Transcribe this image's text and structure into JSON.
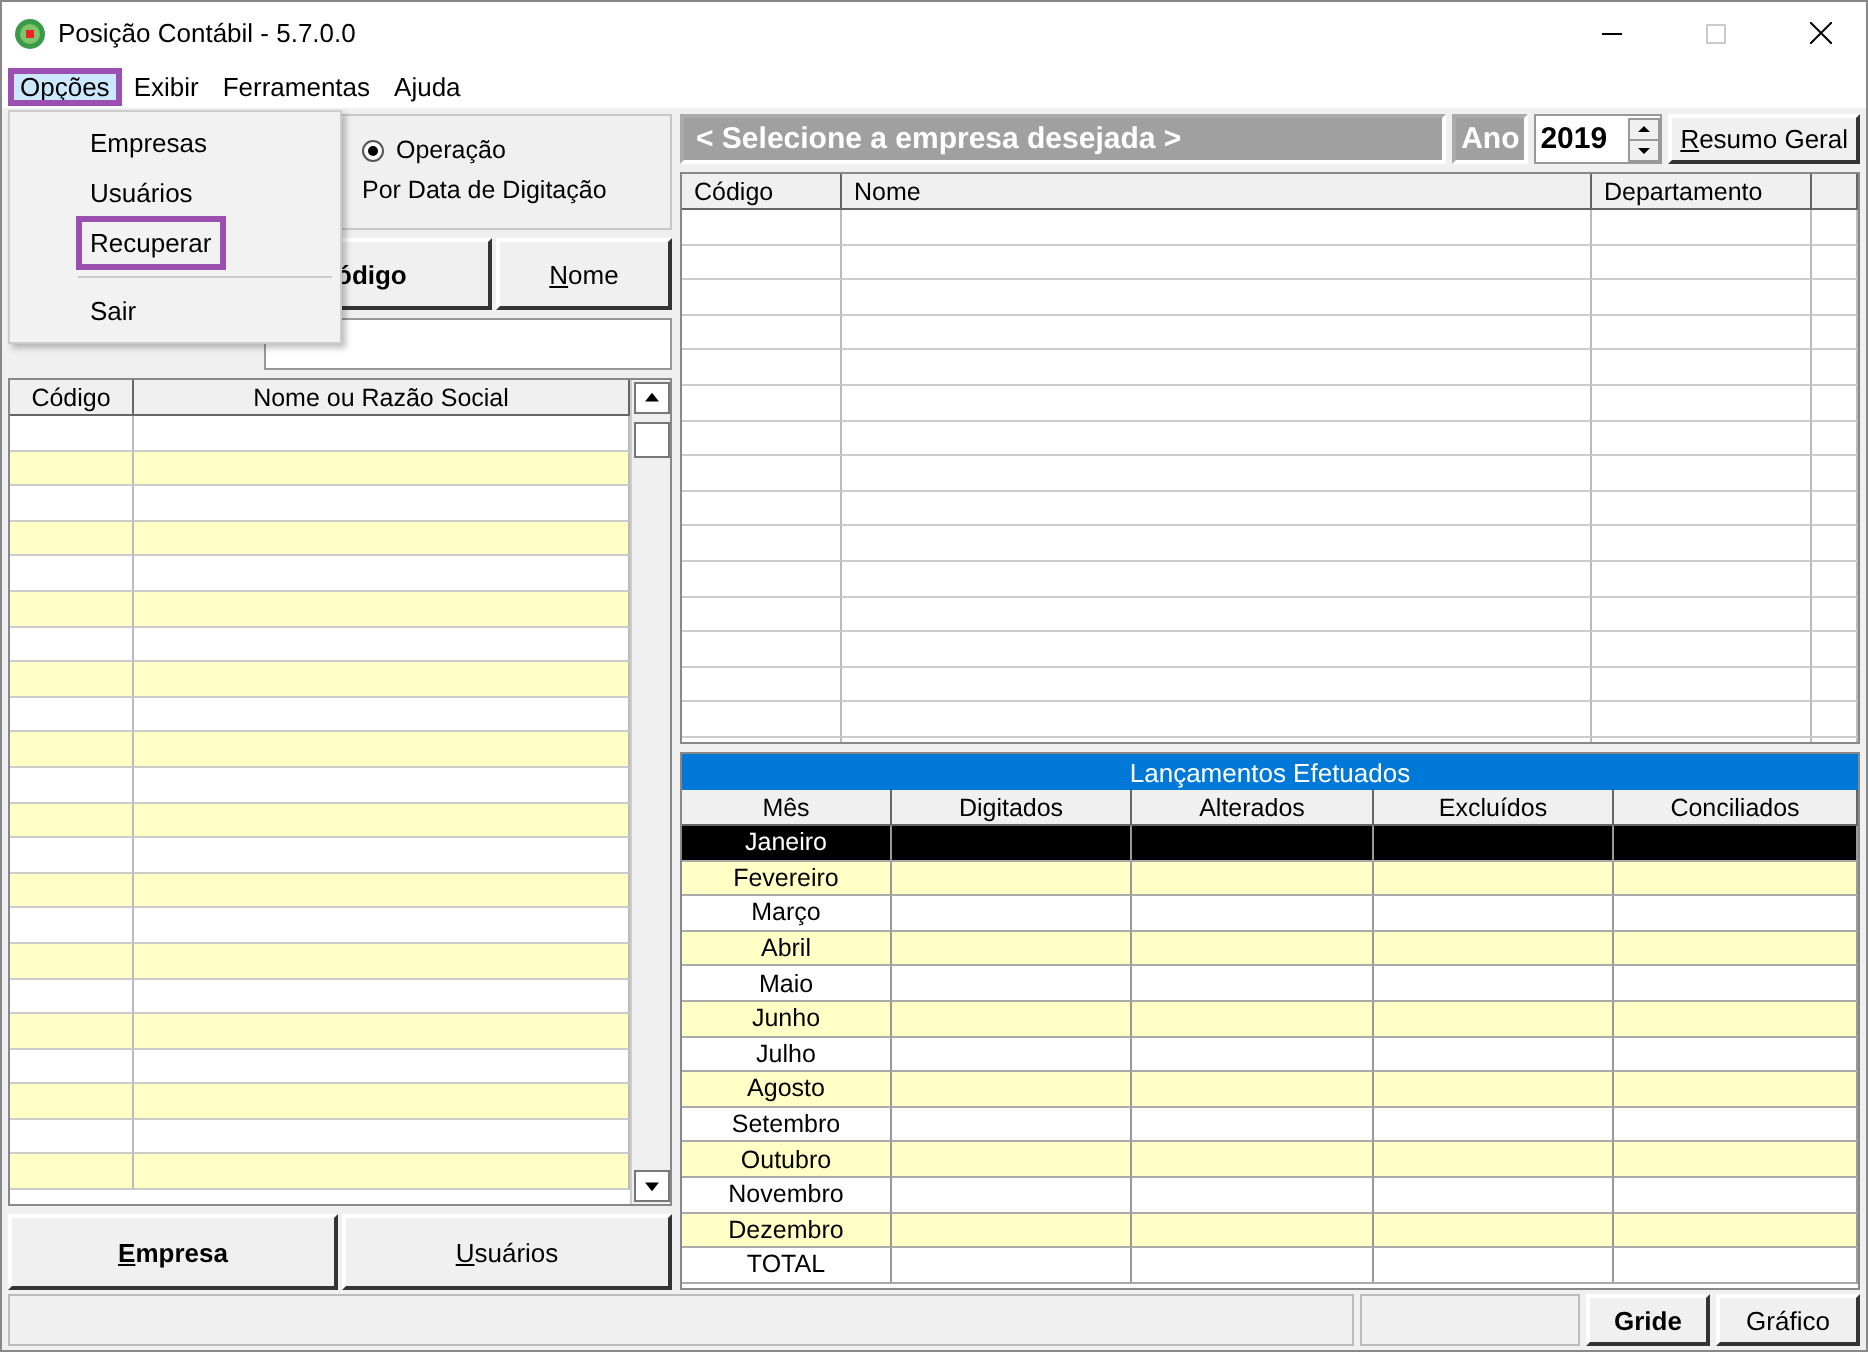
{
  "window": {
    "title": "Posição Contábil - 5.7.0.0"
  },
  "menu": [
    {
      "label": "Opções",
      "selected": true
    },
    {
      "label": "Exibir",
      "selected": false
    },
    {
      "label": "Ferramentas",
      "selected": false
    },
    {
      "label": "Ajuda",
      "selected": false
    }
  ],
  "dropdown": [
    {
      "kind": "item",
      "label": "Empresas",
      "highlighted": false
    },
    {
      "kind": "item",
      "label": "Usuários",
      "highlighted": false
    },
    {
      "kind": "item",
      "label": "Recuperar",
      "highlighted": true
    },
    {
      "kind": "separator"
    },
    {
      "kind": "item",
      "label": "Sair",
      "highlighted": false
    }
  ],
  "options_group": {
    "radio_label": "Operação",
    "radio_selected": true,
    "caption": "Por Data de Digitação"
  },
  "sort_buttons": [
    {
      "label": "ódigo",
      "selected": true
    },
    {
      "label": "Nome",
      "selected": false
    }
  ],
  "company_table": {
    "columns": [
      "Código",
      "Nome ou Razão Social"
    ]
  },
  "left_buttons": [
    {
      "label": "Empresa",
      "selected": true
    },
    {
      "label": "Usuários",
      "selected": false
    }
  ],
  "company_header": {
    "prompt": "< Selecione a empresa desejada >",
    "year_label": "Ano",
    "year": "2019",
    "summary_button": "Resumo Geral"
  },
  "department_table": {
    "columns": [
      "Código",
      "Nome",
      "Departamento"
    ]
  },
  "entries_table": {
    "title": "Lançamentos Efetuados",
    "columns": [
      "Mês",
      "Digitados",
      "Alterados",
      "Excluídos",
      "Conciliados"
    ],
    "rows": [
      {
        "month": "Janeiro",
        "selected": true
      },
      {
        "month": "Fevereiro",
        "selected": false
      },
      {
        "month": "Março",
        "selected": false
      },
      {
        "month": "Abril",
        "selected": false
      },
      {
        "month": "Maio",
        "selected": false
      },
      {
        "month": "Junho",
        "selected": false
      },
      {
        "month": "Julho",
        "selected": false
      },
      {
        "month": "Agosto",
        "selected": false
      },
      {
        "month": "Setembro",
        "selected": false
      },
      {
        "month": "Outubro",
        "selected": false
      },
      {
        "month": "Novembro",
        "selected": false
      },
      {
        "month": "Dezembro",
        "selected": false
      },
      {
        "month": "TOTAL",
        "selected": false
      }
    ]
  },
  "view_buttons": [
    {
      "label": "Gride",
      "selected": true
    },
    {
      "label": "Gráfico",
      "selected": false
    }
  ]
}
